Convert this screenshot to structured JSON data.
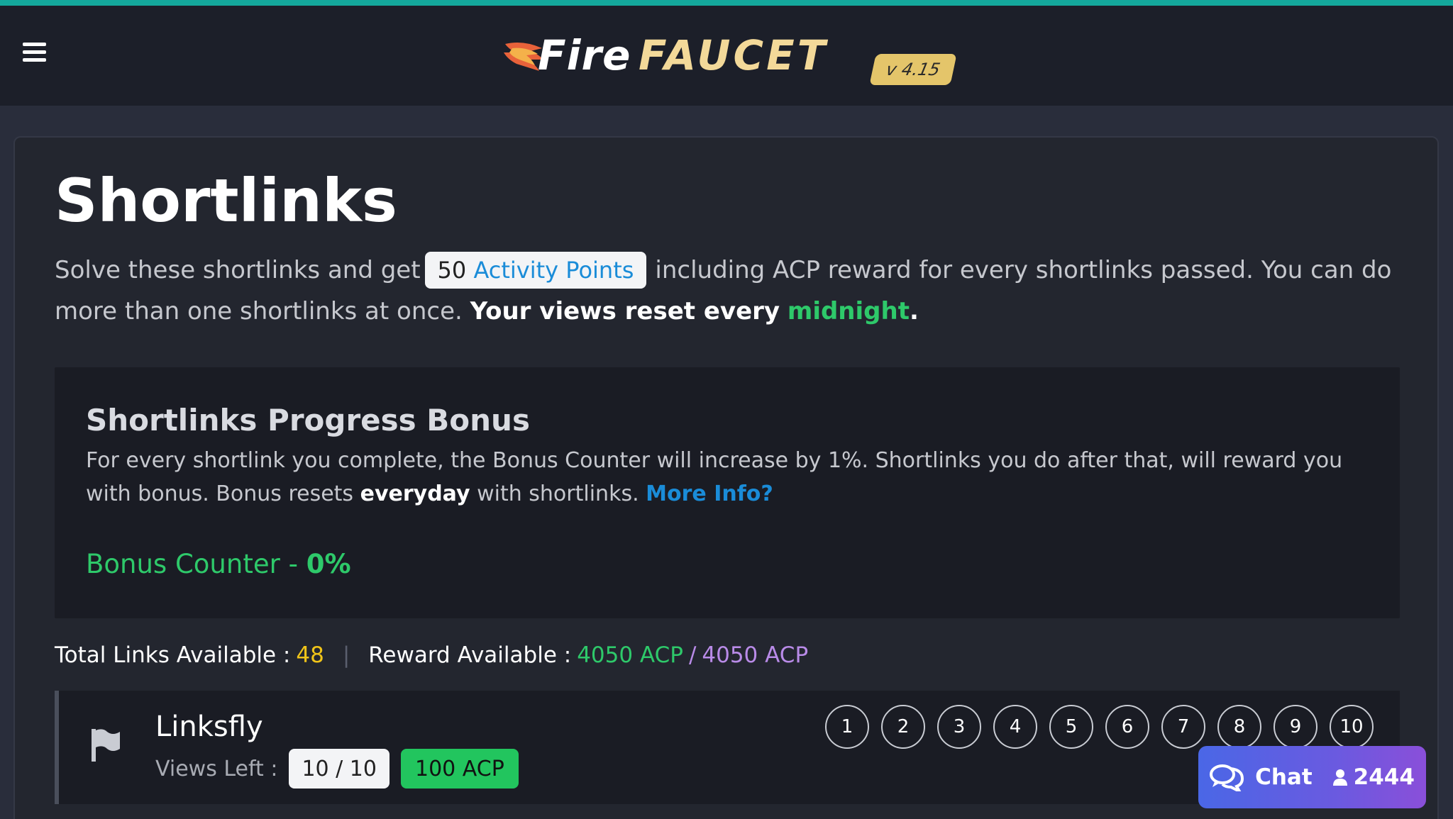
{
  "header": {
    "logo_fire": "Fire",
    "logo_faucet": "FAUCET",
    "version": "v 4.15",
    "accent_color": "#14a89c"
  },
  "page": {
    "title": "Shortlinks",
    "intro_before": "Solve these shortlinks and get",
    "activity_points_value": "50",
    "activity_points_label": "Activity Points",
    "intro_after": "including ACP reward for every shortlinks passed. You can do more than one shortlinks at once.",
    "views_reset_label": "Your views reset every",
    "views_reset_time": "midnight",
    "period": "."
  },
  "bonus": {
    "title": "Shortlinks Progress Bonus",
    "description_1": "For every shortlink you complete, the Bonus Counter will increase by 1%. Shortlinks you do after that, will reward you with bonus. Bonus resets",
    "description_bold": "everyday",
    "description_2": "with shortlinks.",
    "more_info": "More Info?",
    "counter_label": "Bonus Counter -",
    "counter_value": "0%"
  },
  "stats": {
    "total_links_label": "Total Links Available :",
    "total_links_value": "48",
    "separator": "|",
    "reward_label": "Reward Available :",
    "reward_current": "4050 ACP",
    "reward_slash": "/",
    "reward_total": "4050 ACP"
  },
  "shortlink": {
    "name": "Linksfly",
    "views_label": "Views Left :",
    "views_value": "10 / 10",
    "reward": "100 ACP",
    "view_numbers": [
      "1",
      "2",
      "3",
      "4",
      "5",
      "6",
      "7",
      "8",
      "9",
      "10"
    ]
  },
  "chat": {
    "label": "Chat",
    "online_count": "2444"
  },
  "icons": [
    "menu-icon",
    "flame-icon",
    "flag-icon",
    "chat-bubbles-icon",
    "user-icon"
  ]
}
